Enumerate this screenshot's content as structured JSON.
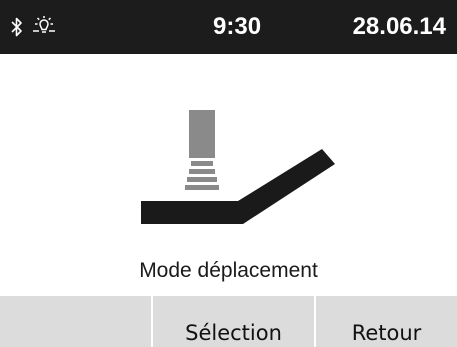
{
  "status_bar": {
    "bluetooth_icon": "bluetooth-icon",
    "light_icon": "light-bulb-icon",
    "time": "9:30",
    "date": "28.06.14"
  },
  "main": {
    "illustration": "slider-on-ramp-icon",
    "mode_label": "Mode déplacement"
  },
  "softkeys": [
    {
      "label": ""
    },
    {
      "label": "Sélection"
    },
    {
      "label": "Retour"
    }
  ],
  "colors": {
    "status_bar_bg": "#1c1c1c",
    "softkey_bg": "#dcdcdc",
    "illustration_dark": "#1a1a1a",
    "illustration_gray": "#8a8a8a"
  }
}
